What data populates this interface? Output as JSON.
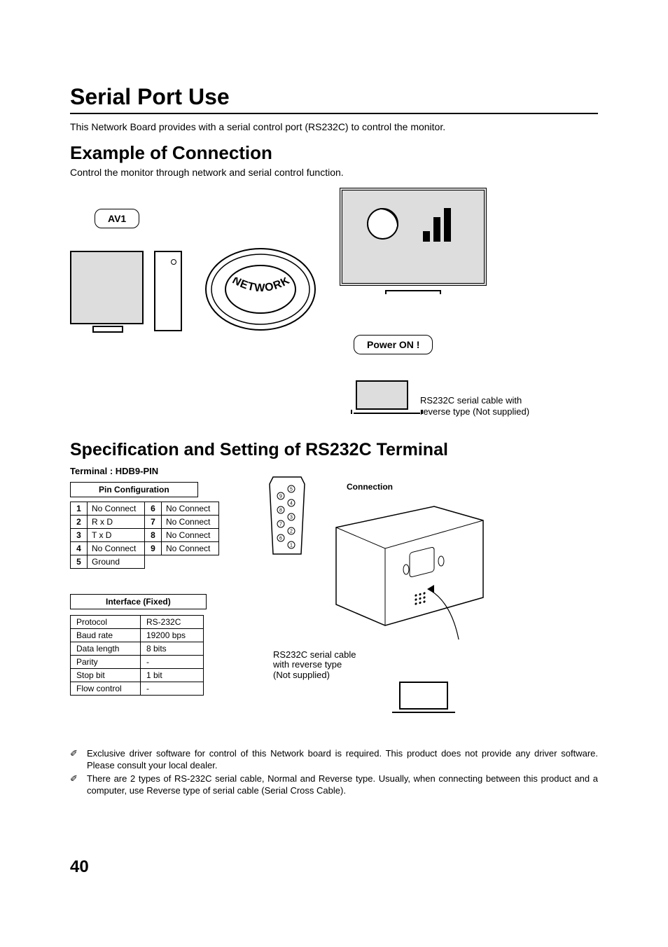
{
  "headings": {
    "h1": "Serial Port Use",
    "intro": "This Network Board provides with a serial control port (RS232C) to control the monitor.",
    "h2a": "Example of Connection",
    "sub_a": "Control the monitor through network and serial control function.",
    "h2b": "Specification and Setting of RS232C Terminal"
  },
  "diagram": {
    "av1": "AV1",
    "poweron": "Power ON !",
    "network_label": "NETWORK",
    "rs_note_l1": "RS232C serial cable with",
    "rs_note_l2": "reverse type (Not supplied)"
  },
  "spec": {
    "terminal_label": "Terminal : HDB9-PIN",
    "pin_title": "Pin Configuration",
    "pins": [
      {
        "n": "1",
        "v": "No Connect"
      },
      {
        "n": "2",
        "v": "R x D"
      },
      {
        "n": "3",
        "v": "T x D"
      },
      {
        "n": "4",
        "v": "No Connect"
      },
      {
        "n": "5",
        "v": "Ground"
      },
      {
        "n": "6",
        "v": "No Connect"
      },
      {
        "n": "7",
        "v": "No Connect"
      },
      {
        "n": "8",
        "v": "No Connect"
      },
      {
        "n": "9",
        "v": "No Connect"
      }
    ],
    "iface_title": "Interface (Fixed)",
    "iface": [
      {
        "k": "Protocol",
        "v": "RS-232C"
      },
      {
        "k": "Baud rate",
        "v": "19200 bps"
      },
      {
        "k": "Data length",
        "v": "8 bits"
      },
      {
        "k": "Parity",
        "v": "-"
      },
      {
        "k": "Stop bit",
        "v": "1 bit"
      },
      {
        "k": "Flow control",
        "v": "-"
      }
    ],
    "conn_title": "Connection",
    "rs2_l1": "RS232C serial cable",
    "rs2_l2": "with reverse type",
    "rs2_l3": "(Not supplied)"
  },
  "notes": {
    "n1": "Exclusive driver software for control of this Network board is required. This product does not provide any driver software. Please consult your local dealer.",
    "n2": "There are 2 types of RS-232C serial cable, Normal and Reverse type. Usually, when connecting between this product and a computer, use Reverse type of serial cable (Serial Cross Cable)."
  },
  "page": "40"
}
